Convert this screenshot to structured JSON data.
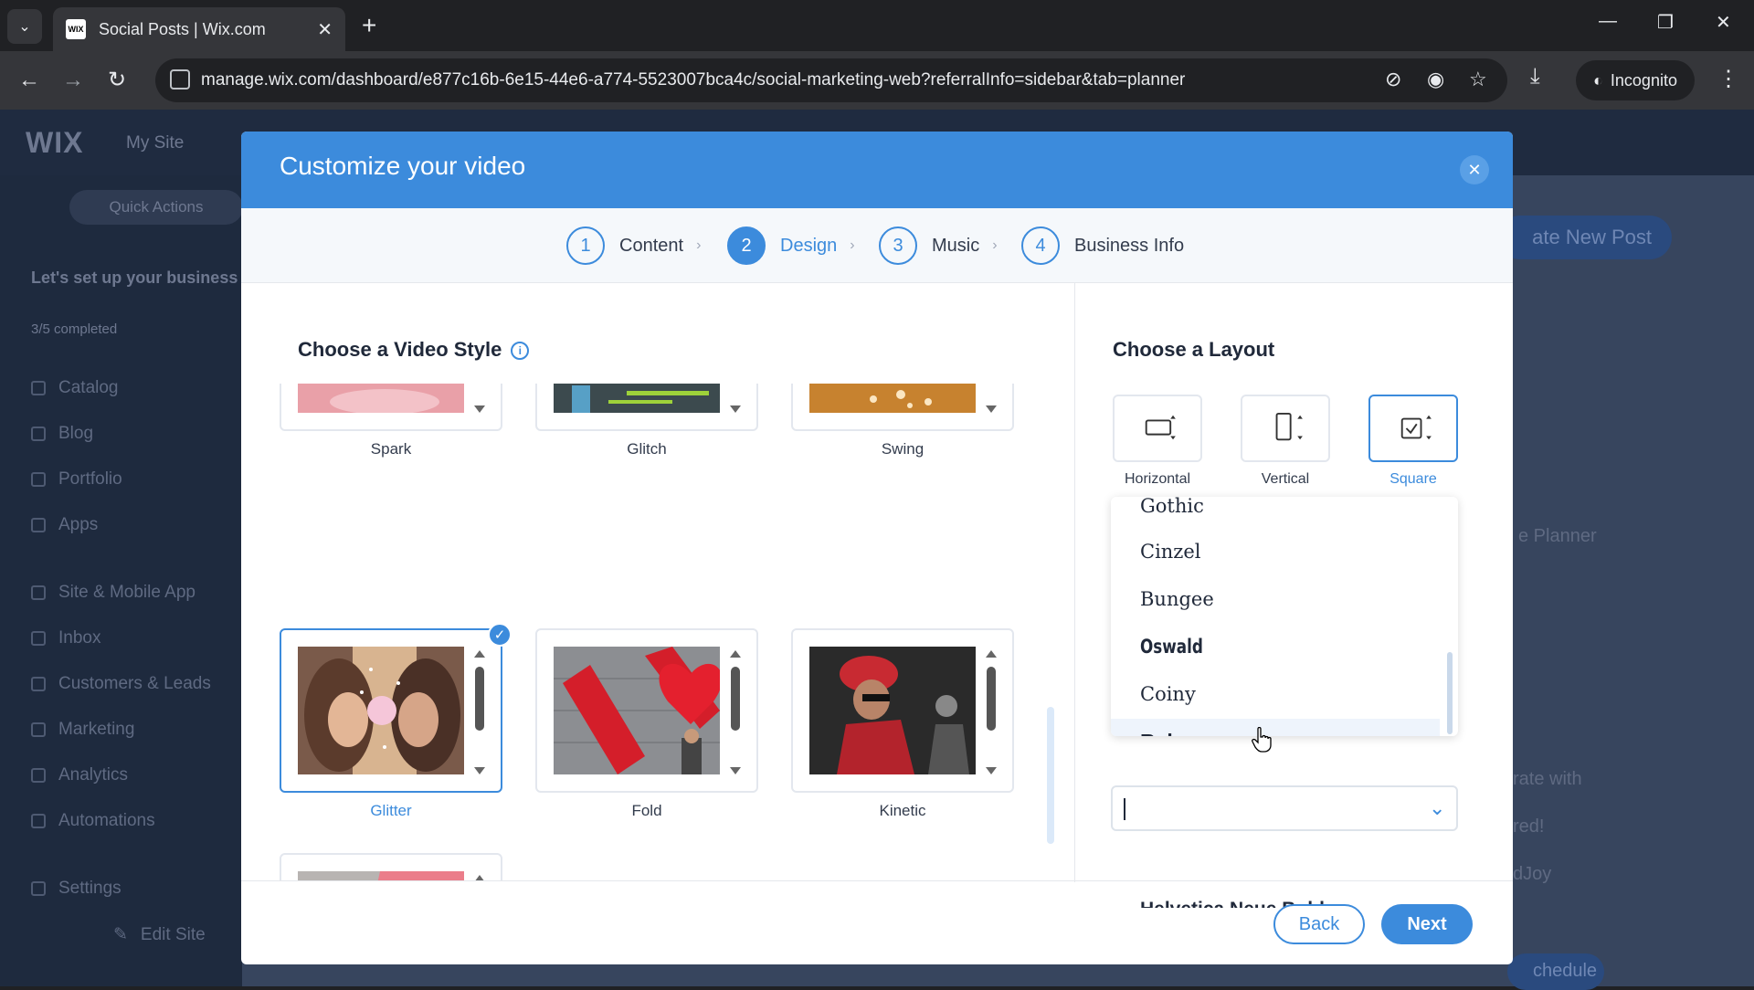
{
  "browser": {
    "tab_title": "Social Posts | Wix.com",
    "favicon_text": "WIX",
    "url": "manage.wix.com/dashboard/e877c16b-6e15-44e6-a774-5523007bca4c/social-marketing-web?referralInfo=sidebar&tab=planner",
    "incognito_label": "Incognito"
  },
  "dashboard": {
    "logo": "WIX",
    "site_name": "My Site",
    "quick_actions": "Quick Actions",
    "setup_title": "Let's set up your business",
    "progress": "3/5 completed",
    "sidebar_items": [
      "Catalog",
      "Blog",
      "Portfolio",
      "Apps",
      "Site & Mobile App",
      "Inbox",
      "Customers & Leads",
      "Marketing",
      "Analytics",
      "Automations",
      "Settings"
    ],
    "edit_site": "Edit Site",
    "create_post": "ate New Post",
    "planner": "e Planner",
    "ghost_lines": [
      "rate with",
      "red!",
      "dJoy"
    ],
    "schedule": "chedule"
  },
  "modal": {
    "title": "Customize your video",
    "steps": [
      {
        "num": "1",
        "label": "Content"
      },
      {
        "num": "2",
        "label": "Design"
      },
      {
        "num": "3",
        "label": "Music"
      },
      {
        "num": "4",
        "label": "Business Info"
      }
    ],
    "active_step": 2,
    "video_style_title": "Choose a Video Style",
    "styles": [
      {
        "label": "Spark"
      },
      {
        "label": "Glitch"
      },
      {
        "label": "Swing"
      },
      {
        "label": "Glitter",
        "selected": true
      },
      {
        "label": "Fold"
      },
      {
        "label": "Kinetic"
      },
      {
        "label": ""
      }
    ],
    "layout_title": "Choose a Layout",
    "layouts": [
      {
        "label": "Horizontal"
      },
      {
        "label": "Vertical"
      },
      {
        "label": "Square",
        "selected": true
      }
    ],
    "fonts": [
      "Gothic",
      "Cinzel",
      "Bungee",
      "Oswald",
      "Coiny",
      "Raleway",
      "Helvetica Neue Bold"
    ],
    "hovered_font": "Raleway",
    "select_value": "",
    "back_label": "Back",
    "next_label": "Next"
  },
  "colors": {
    "accent": "#3c8bdc",
    "header": "#3c8bdc"
  }
}
